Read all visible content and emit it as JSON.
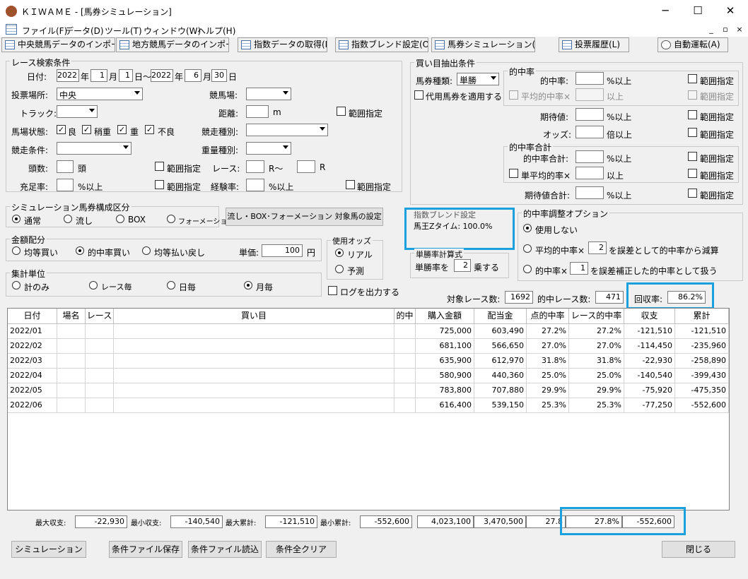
{
  "window": {
    "title": "ＫＩＷＡＭＥ - [馬券シミュレーション]",
    "min": "─",
    "max": "☐",
    "close": "✕"
  },
  "menu": [
    "ファイル(F)",
    "データ(D)",
    "ツール(T)",
    "ウィンドウ(W)",
    "ヘルプ(H)"
  ],
  "mdi": {
    "min": "_",
    "restore": "▫",
    "close": "×"
  },
  "tabs": [
    "中央競馬データのインポート(J)",
    "地方競馬データのインポート(N)",
    "指数データの取得(I)",
    "指数ブレンド設定(O)",
    "馬券シミュレーション(B)",
    "投票履歴(L)",
    "自動運転(A)"
  ],
  "race_search": {
    "title": "レース検索条件",
    "date_label": "日付:",
    "date_from": {
      "year": "2022",
      "month": "1",
      "day": "1"
    },
    "date_to": {
      "year": "2022",
      "month": "6",
      "day": "30"
    },
    "u_year": "年",
    "u_month": "月",
    "u_day": "日",
    "u_day_tilde": "日～",
    "venue_label": "投票場所:",
    "venue_value": "中央",
    "course_label": "競馬場:",
    "course_value": "",
    "track_label": "トラック:",
    "track_value": "",
    "distance_label": "距離:",
    "distance_value": "",
    "distance_unit": "m",
    "range_label": "範囲指定",
    "condition_label": "馬場状態:",
    "conditions": [
      "良",
      "稍重",
      "重",
      "不良"
    ],
    "race_type_label": "競走種別:",
    "race_type_value": "",
    "race_cond_label": "競走条件:",
    "race_cond_value": "",
    "weight_label": "重量種別:",
    "weight_value": "",
    "heads_label": "頭数:",
    "heads_value": "",
    "heads_unit": "頭",
    "race_label": "レース:",
    "race_from": "",
    "race_from_unit": "R～",
    "race_to": "",
    "race_to_unit": "R",
    "fill_label": "充足率:",
    "fill_value": "",
    "fill_unit": "%以上",
    "exp_label": "経験率:",
    "exp_value": "",
    "exp_unit": "%以上"
  },
  "sim_section": {
    "title": "シミュレーション馬券構成区分",
    "options": [
      "通常",
      "流し",
      "BOX",
      "フォーメーション"
    ],
    "flow_button": "流し・BOX･フォーメーション 対象馬の設定"
  },
  "amount_section": {
    "title": "金額配分",
    "options": [
      "均等買い",
      "的中率買い",
      "均等払い戻し"
    ],
    "unit_label": "単価:",
    "unit_value": "100",
    "unit_suffix": "円"
  },
  "odds_section": {
    "title": "使用オッズ",
    "options": [
      "リアル",
      "予測"
    ]
  },
  "agg_section": {
    "title": "集計単位",
    "options": [
      "計のみ",
      "レース毎",
      "日毎",
      "月毎"
    ]
  },
  "log_label": "ログを出力する",
  "buy_section": {
    "title": "買い目抽出条件",
    "type_label": "馬券種類:",
    "type_value": "単勝",
    "substitute_label": "代用馬券を適用する",
    "hit_title": "的中率",
    "hit_label": "的中率:",
    "pct_above": "%以上",
    "avg_hit_label": "平均的中率×",
    "above": "以上",
    "ev_label": "期待値:",
    "odds_label": "オッズ:",
    "times_above": "倍以上",
    "hit_sum_title": "的中率合計",
    "hit_sum_label": "的中率合計:",
    "single_avg_label": "単平均的率×",
    "ev_sum_label": "期待値合計:",
    "range_label": "範囲指定"
  },
  "blend": {
    "title": "指数ブレンド設定",
    "content": "馬王Zタイム: 100.0%"
  },
  "win_calc": {
    "title": "単勝率計算式",
    "label": "単勝率を",
    "value": "2",
    "suffix": "乗する"
  },
  "adjust": {
    "title": "的中率調整オプション",
    "opt1": "使用しない",
    "opt2_pre": "平均的中率×",
    "opt2_value": "2",
    "opt2_post": "を誤差として的中率から減算",
    "opt3_pre": "的中率×",
    "opt3_value": "1",
    "opt3_post": "を誤差補正した的中率として扱う"
  },
  "stats": {
    "target_label": "対象レース数:",
    "target_value": "1692",
    "hit_label": "的中レース数:",
    "hit_value": "471",
    "return_label": "回収率:",
    "return_value": "86.2%"
  },
  "table": {
    "headers": [
      "日付",
      "場名",
      "レース",
      "買い目",
      "的中",
      "購入金額",
      "配当金",
      "点的中率",
      "レース的中率",
      "収支",
      "累計"
    ],
    "rows": [
      [
        "2022/01",
        "",
        "",
        "",
        "",
        "725,000",
        "603,490",
        "27.2%",
        "27.2%",
        "-121,510",
        "-121,510"
      ],
      [
        "2022/02",
        "",
        "",
        "",
        "",
        "681,100",
        "566,650",
        "27.0%",
        "27.0%",
        "-114,450",
        "-235,960"
      ],
      [
        "2022/03",
        "",
        "",
        "",
        "",
        "635,900",
        "612,970",
        "31.8%",
        "31.8%",
        "-22,930",
        "-258,890"
      ],
      [
        "2022/04",
        "",
        "",
        "",
        "",
        "580,900",
        "440,360",
        "25.0%",
        "25.0%",
        "-140,540",
        "-399,430"
      ],
      [
        "2022/05",
        "",
        "",
        "",
        "",
        "783,800",
        "707,880",
        "29.9%",
        "29.9%",
        "-75,920",
        "-475,350"
      ],
      [
        "2022/06",
        "",
        "",
        "",
        "",
        "616,400",
        "539,150",
        "25.3%",
        "25.3%",
        "-77,250",
        "-552,600"
      ]
    ]
  },
  "summary": {
    "max_income_label": "最大収支:",
    "max_income": "-22,930",
    "min_income_label": "最小収支:",
    "min_income": "-140,540",
    "max_total_label": "最大累計:",
    "max_total": "-121,510",
    "min_total_label": "最小累計:",
    "min_total": "-552,600",
    "purchase_total": "4,023,100",
    "payout_total": "3,470,500",
    "point_hit": "27.8",
    "race_hit": "27.8%",
    "income_total": "-552,600"
  },
  "buttons": {
    "simulate": "シミュレーション",
    "save": "条件ファイル保存",
    "load": "条件ファイル読込",
    "clear": "条件全クリア",
    "close": "閉じる"
  },
  "colors": {
    "highlight": "#1aa0dc"
  }
}
